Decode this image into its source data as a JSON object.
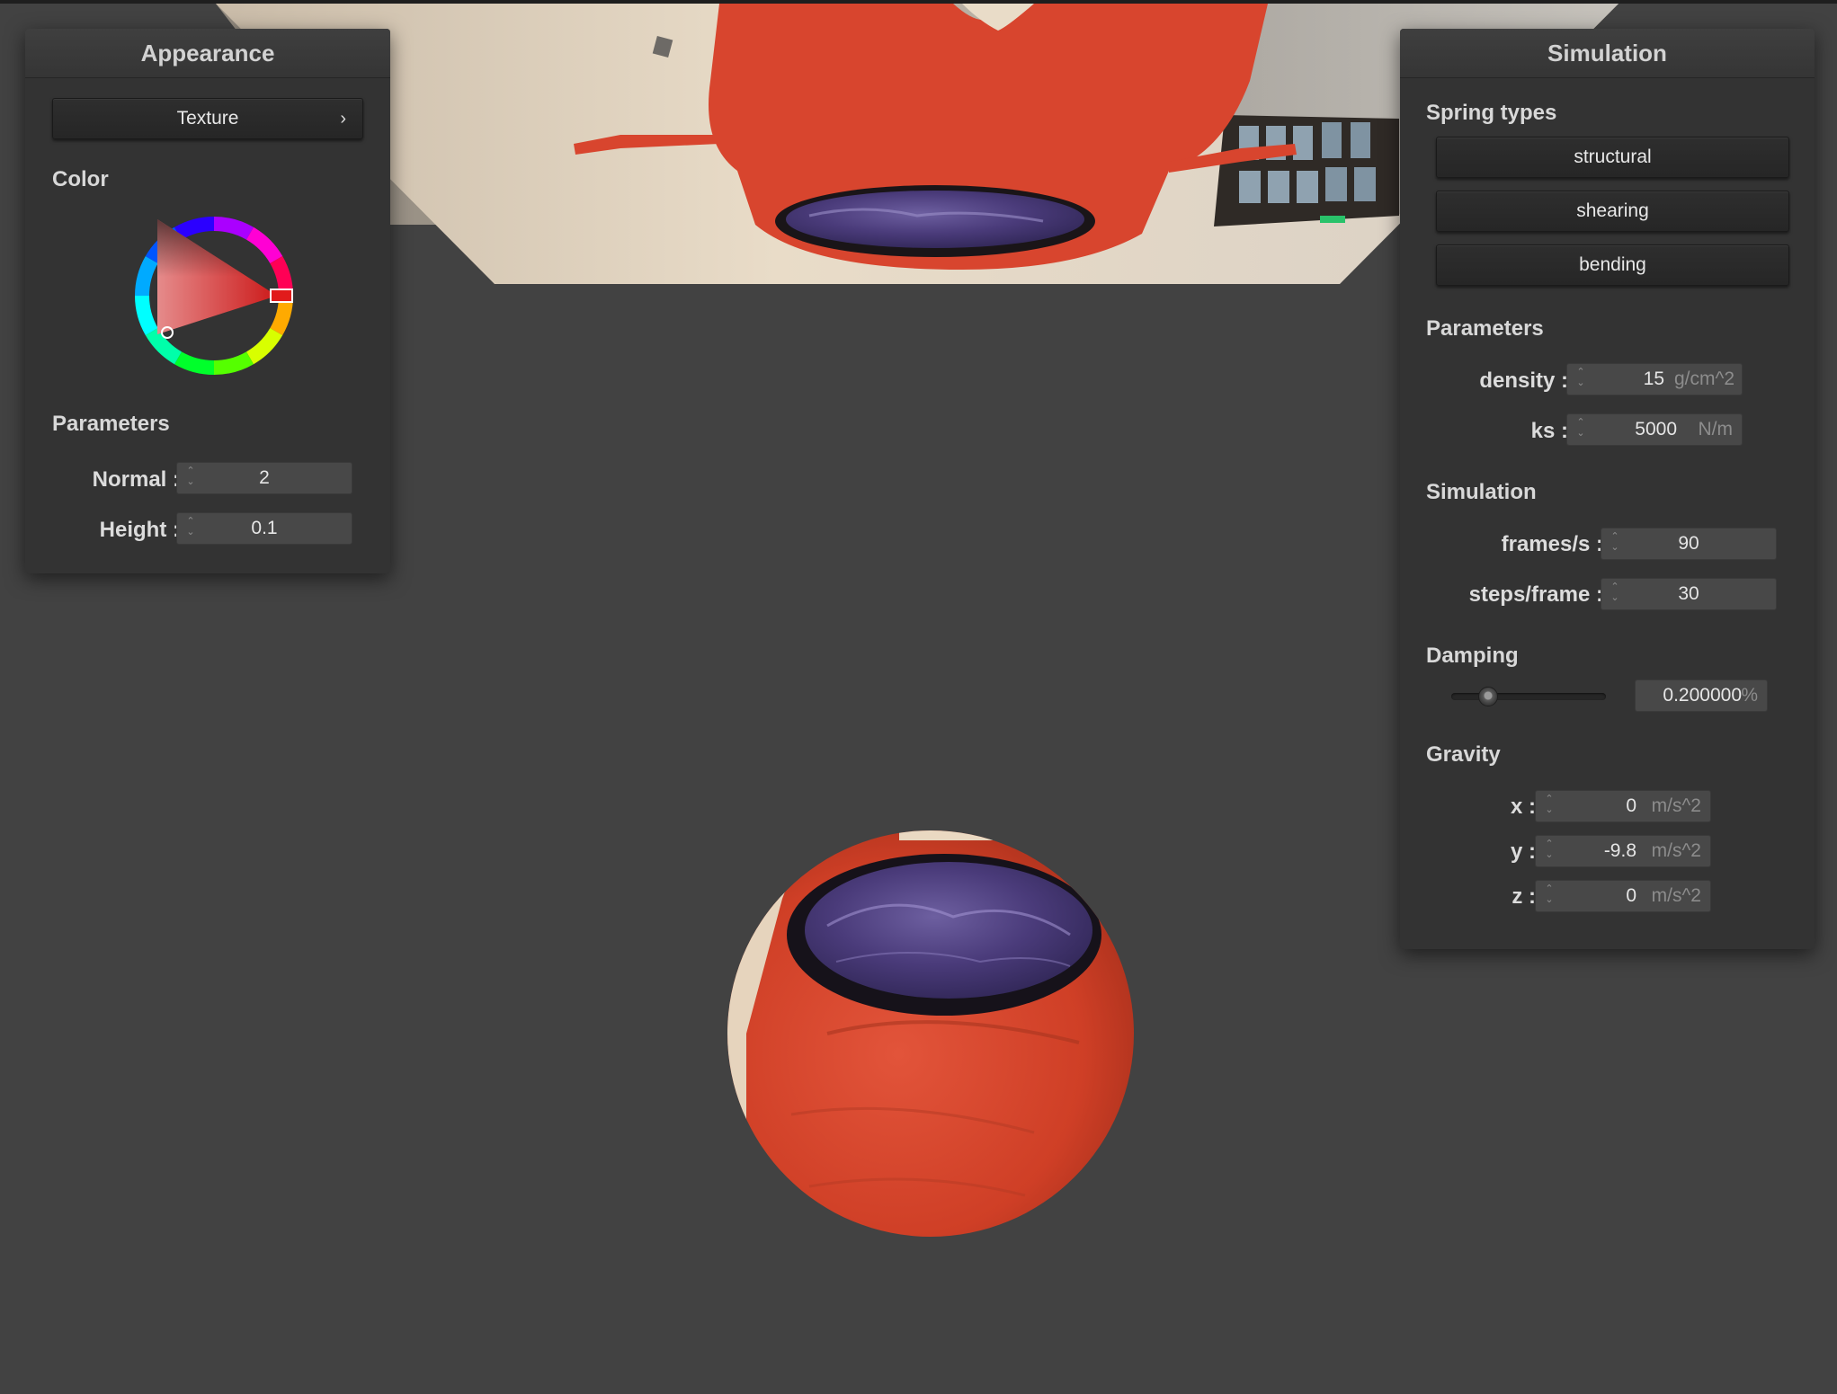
{
  "appearance_panel": {
    "title": "Appearance",
    "texture_button": "Texture",
    "chevron": "›",
    "color_label": "Color",
    "parameters_label": "Parameters",
    "normal_label": "Normal :",
    "normal_value": "2",
    "height_label": "Height :",
    "height_value": "0.1",
    "selected_color": "#e11b1b"
  },
  "simulation_panel": {
    "title": "Simulation",
    "spring_types_label": "Spring types",
    "spring_buttons": [
      "structural",
      "shearing",
      "bending"
    ],
    "parameters_label": "Parameters",
    "density_label": "density :",
    "density_value": "15",
    "density_unit": "g/cm^2",
    "ks_label": "ks :",
    "ks_value": "5000",
    "ks_unit": "N/m",
    "simulation_label": "Simulation",
    "fps_label": "frames/s :",
    "fps_value": "90",
    "steps_label": "steps/frame :",
    "steps_value": "30",
    "damping_label": "Damping",
    "damping_value": "0.200000",
    "damping_unit": "%",
    "damping_slider_fraction": 0.2,
    "gravity_label": "Gravity",
    "gravity_x_label": "x :",
    "gravity_x_value": "0",
    "gravity_y_label": "y :",
    "gravity_y_value": "-9.8",
    "gravity_z_label": "z :",
    "gravity_z_value": "0",
    "gravity_unit": "m/s^2"
  },
  "colors": {
    "background": "#424242",
    "panel": "#333333",
    "cloth_red": "#d8452e"
  }
}
